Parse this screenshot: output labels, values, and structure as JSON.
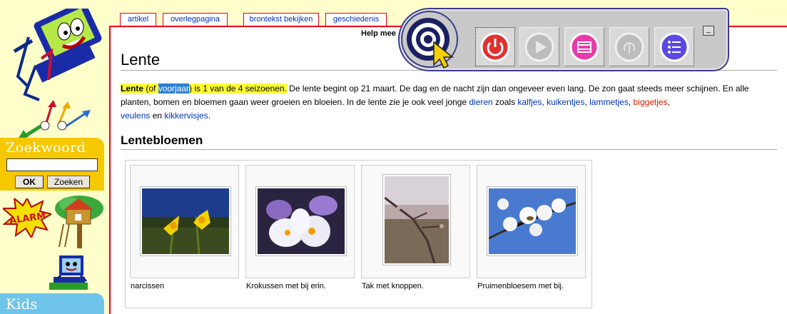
{
  "sidebar": {
    "search_title": "Zoekwoord",
    "search_value": "",
    "ok_label": "OK",
    "search_button_label": "Zoeken",
    "kids_title": "Kids",
    "alarm_text": "ALARM"
  },
  "tabs": {
    "artikel": "artikel",
    "overleg": "overlegpagina",
    "bron": "brontekst bekijken",
    "geschiedenis": "geschiedenis"
  },
  "help_text": "Help mee",
  "article": {
    "title": "Lente",
    "intro": {
      "bold": "Lente",
      "of_open": " (of ",
      "voorjaar": "voorjaar",
      "rest_highlight": ") is 1 van de 4 seizoenen.",
      "sentence1": " De lente begint op 21 maart. De dag en de nacht zijn dan ongeveer even lang. De zon gaat steeds meer schijnen. En alle planten, bomen en bloemen gaan weer groeien en bloeien. In de lente zie je ook veel jonge ",
      "link_dieren": "dieren",
      "zoals": " zoals ",
      "link_kalfjes": "kalfjes",
      "comma1": ", ",
      "link_kuikentjes": "kuikentjes",
      "comma2": ", ",
      "link_lammetjes": "lammetjes",
      "comma3": ", ",
      "link_biggetjes": "biggetjes",
      "comma4": ", ",
      "link_veulens": "veulens",
      "en": " en ",
      "link_kikkervisjes": "kikkervisjes",
      "period": "."
    },
    "section_title": "Lentebloemen",
    "gallery": [
      {
        "caption": "narcissen"
      },
      {
        "caption": "Krokussen met bij erin."
      },
      {
        "caption": "Tak met knoppen."
      },
      {
        "caption": "Pruimenbloesem met bij."
      }
    ]
  },
  "colors": {
    "accent_red": "#e8001c",
    "link_blue": "#0033bb",
    "sidebar_bg": "#ffffcc",
    "search_yellow": "#f6c800",
    "kids_blue": "#6fc4ea",
    "highlight_yellow": "#ffff33"
  },
  "toolbar": {
    "buttons": [
      "power-icon",
      "play-icon",
      "page-icon",
      "speaker-icon",
      "list-icon"
    ],
    "minimize_label": "_"
  }
}
